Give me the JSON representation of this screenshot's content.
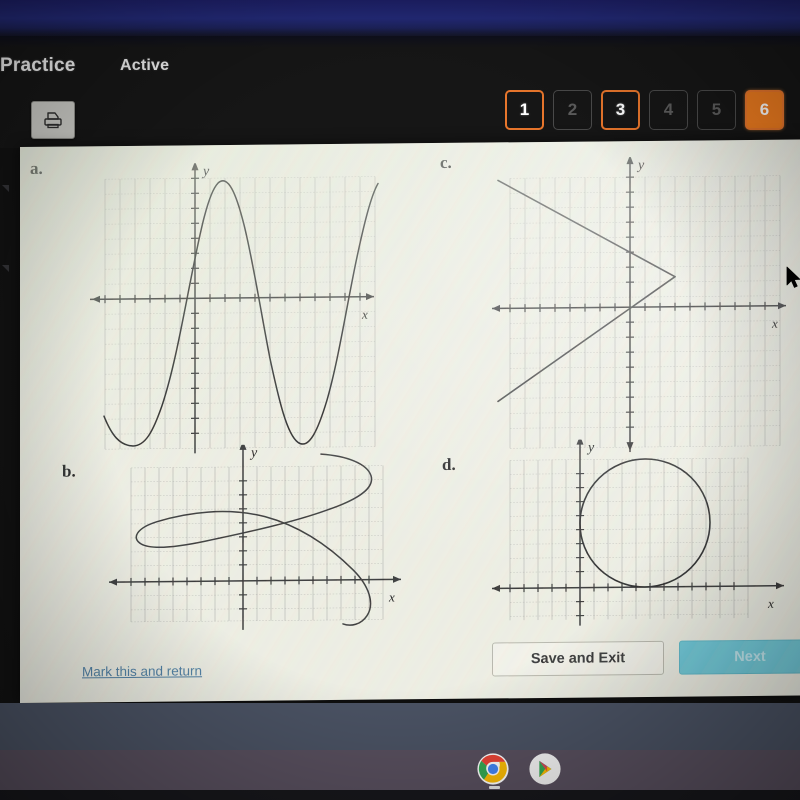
{
  "header": {
    "title": "Practice",
    "tab_label": "Active",
    "print_icon": "printer-icon"
  },
  "pager": {
    "items": [
      {
        "label": "1",
        "state": "done"
      },
      {
        "label": "2",
        "state": "todo"
      },
      {
        "label": "3",
        "state": "done"
      },
      {
        "label": "4",
        "state": "todo"
      },
      {
        "label": "5",
        "state": "todo"
      },
      {
        "label": "6",
        "state": "current"
      }
    ],
    "accent_color": "#e8762c",
    "current_fill": "#ef7c1f",
    "inactive_color": "#5c5c5c"
  },
  "answers": {
    "a": {
      "label": "a.",
      "graph": "vertical-sine-wave"
    },
    "b": {
      "label": "b.",
      "graph": "horizontal-sine-wave"
    },
    "c": {
      "label": "c.",
      "graph": "sideways-v-lines"
    },
    "d": {
      "label": "d.",
      "graph": "circle"
    }
  },
  "footer": {
    "mark_link": "Mark this and return",
    "save_label": "Save and Exit",
    "next_label": "Next",
    "next_color": "#6fc9d8",
    "link_color": "#4f7fa3"
  },
  "shelf": {
    "icons": [
      {
        "name": "chrome-icon"
      },
      {
        "name": "play-store-icon"
      }
    ]
  },
  "chart_data": [
    {
      "id": "a",
      "type": "line",
      "title": "a.",
      "xlabel": "x",
      "ylabel": "y",
      "grid": true,
      "xlim": [
        -7,
        12
      ],
      "ylim": [
        -9,
        9
      ],
      "description": "Cosine-like wave, about two full periods, amplitude 8, period 9 units; passes vertical line test",
      "function": "y = 8*cos((2*pi/9)*(x + 2.5))",
      "points": [
        {
          "x": -7.0,
          "y": -5.5
        },
        {
          "x": -6.0,
          "y": -7.8
        },
        {
          "x": -5.0,
          "y": -8.0
        },
        {
          "x": -4.0,
          "y": -6.4
        },
        {
          "x": -3.0,
          "y": -3.1
        },
        {
          "x": -2.0,
          "y": 1.0
        },
        {
          "x": -1.0,
          "y": 4.8
        },
        {
          "x": 0.0,
          "y": 7.4
        },
        {
          "x": 0.5,
          "y": 8.0
        },
        {
          "x": 1.5,
          "y": 7.6
        },
        {
          "x": 2.5,
          "y": 5.3
        },
        {
          "x": 3.5,
          "y": 1.6
        },
        {
          "x": 4.5,
          "y": -2.6
        },
        {
          "x": 5.5,
          "y": -6.0
        },
        {
          "x": 6.5,
          "y": -7.9
        },
        {
          "x": 7.5,
          "y": -7.5
        },
        {
          "x": 8.5,
          "y": -4.9
        },
        {
          "x": 9.5,
          "y": -1.1
        },
        {
          "x": 10.5,
          "y": 3.1
        },
        {
          "x": 11.5,
          "y": 6.4
        },
        {
          "x": 12.0,
          "y": 7.6
        }
      ]
    },
    {
      "id": "b",
      "type": "line",
      "title": "b.",
      "xlabel": "x",
      "ylabel": "y",
      "grid": true,
      "xlim": [
        -9,
        10
      ],
      "ylim": [
        -3,
        9
      ],
      "description": "Sine wave rotated 90 degrees (x as a function of y); fails the vertical line test",
      "function": "x = 8*sin((2*pi/11)*(y + 0.3))",
      "points": [
        {
          "x": 1.4,
          "y": -3.0
        },
        {
          "x": 4.0,
          "y": -2.4
        },
        {
          "x": 6.4,
          "y": -1.6
        },
        {
          "x": 7.9,
          "y": -0.7
        },
        {
          "x": 8.0,
          "y": 0.1
        },
        {
          "x": 6.6,
          "y": 1.0
        },
        {
          "x": 4.0,
          "y": 1.8
        },
        {
          "x": 0.8,
          "y": 2.5
        },
        {
          "x": -2.8,
          "y": 3.3
        },
        {
          "x": -6.0,
          "y": 4.2
        },
        {
          "x": -7.8,
          "y": 5.1
        },
        {
          "x": -7.6,
          "y": 6.0
        },
        {
          "x": -5.4,
          "y": 6.9
        },
        {
          "x": -1.8,
          "y": 7.7
        },
        {
          "x": 2.2,
          "y": 8.4
        },
        {
          "x": 5.8,
          "y": 8.9
        },
        {
          "x": 7.9,
          "y": 9.2
        }
      ]
    },
    {
      "id": "c",
      "type": "line",
      "title": "c.",
      "xlabel": "x",
      "ylabel": "y",
      "grid": true,
      "xlim": [
        -10,
        10
      ],
      "ylim": [
        -9,
        9
      ],
      "description": "Two rays meeting at a vertex on the right, forming a sideways V (x = -|y| + 3); fails the vertical line test",
      "vertex": {
        "x": 3.0,
        "y": 2.0
      },
      "series": [
        {
          "name": "upper-ray",
          "points": [
            {
              "x": -10.0,
              "y": 9.0
            },
            {
              "x": 3.0,
              "y": 2.0
            }
          ]
        },
        {
          "name": "lower-ray",
          "points": [
            {
              "x": 3.0,
              "y": 2.0
            },
            {
              "x": -10.0,
              "y": -6.6
            }
          ]
        }
      ]
    },
    {
      "id": "d",
      "type": "line",
      "title": "d.",
      "xlabel": "x",
      "ylabel": "y",
      "grid": true,
      "xlim": [
        -9,
        10
      ],
      "ylim": [
        -3,
        9
      ],
      "description": "Circle in the first quadrant, tangent to the x-axis and tangent to the y-axis; fails the vertical line test",
      "center": {
        "x": 4.6,
        "y": 4.6
      },
      "radius": 4.6
    }
  ]
}
